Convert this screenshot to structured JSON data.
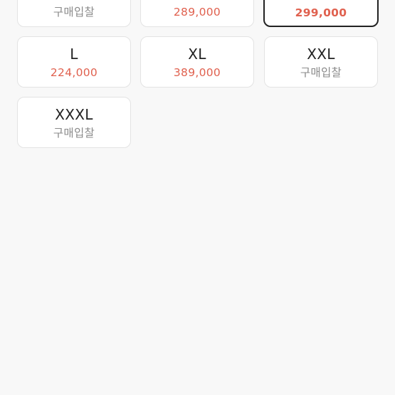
{
  "cards": [
    {
      "size": "",
      "price": "구매입찰",
      "price_kind": "bid"
    },
    {
      "size": "",
      "price": "289,000",
      "price_kind": "price"
    },
    {
      "size": "",
      "price": "299,000",
      "price_kind": "price",
      "selected": true
    },
    {
      "size": "L",
      "price": "224,000",
      "price_kind": "price"
    },
    {
      "size": "XL",
      "price": "389,000",
      "price_kind": "price"
    },
    {
      "size": "XXL",
      "price": "구매입찰",
      "price_kind": "bid"
    },
    {
      "size": "XXXL",
      "price": "구매입찰",
      "price_kind": "bid"
    }
  ],
  "colors": {
    "price": "#e0614f",
    "bid": "#8a8a8a",
    "border": "#e3e3e3",
    "selected_border": "#222222",
    "background": "#f8f8f8"
  }
}
